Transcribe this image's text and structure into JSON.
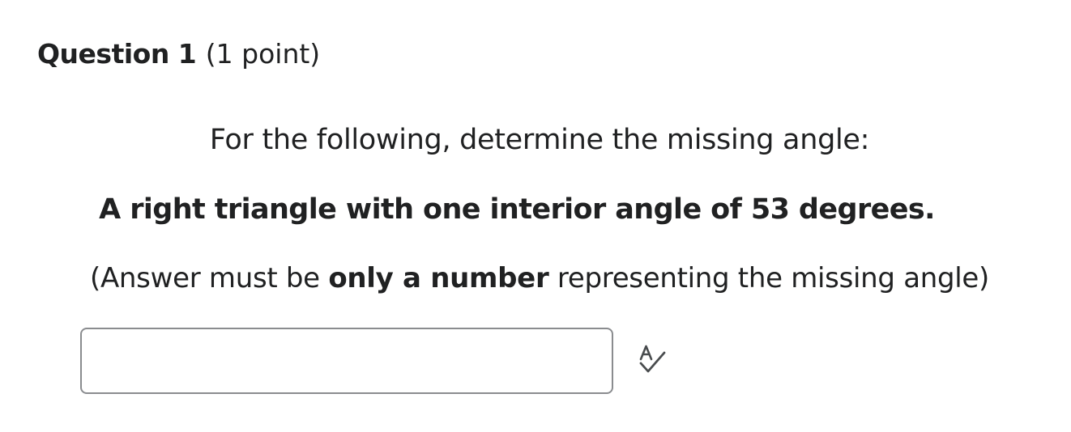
{
  "question": {
    "title": "Question 1",
    "points": "(1 point)"
  },
  "prompt": {
    "instruction": "For the following, determine the missing angle:",
    "problem": "A right triangle with one interior angle of 53 degrees.",
    "note_prefix": "(Answer must be ",
    "note_bold": "only a number",
    "note_suffix": " representing the missing angle)"
  },
  "answer": {
    "value": "",
    "placeholder": ""
  },
  "icons": {
    "spellcheck": "spellcheck-icon"
  }
}
